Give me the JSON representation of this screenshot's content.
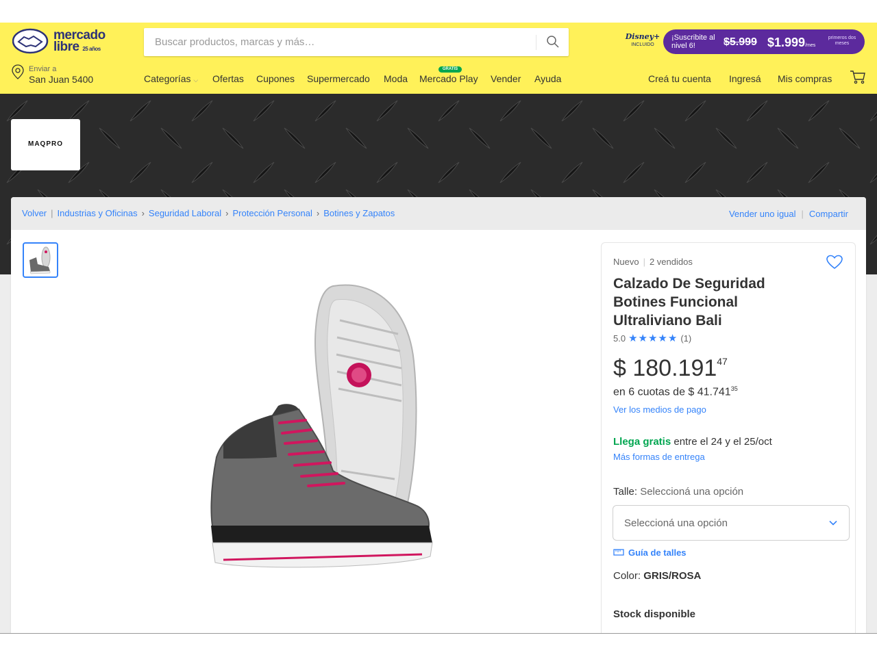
{
  "header": {
    "logo_line1": "mercado",
    "logo_line2": "libre",
    "logo_years": "25 años",
    "search_placeholder": "Buscar productos, marcas y más…",
    "promo": {
      "brand": "Disney+",
      "brand_sub": "INCLUIDO",
      "line1": "¡Suscribite al nivel 6!",
      "old_price": "$5.999",
      "new_price": "$1.999",
      "per": "/mes",
      "note": "primeros dos meses",
      "accent": "#5c2a9d"
    },
    "location_label": "Enviar a",
    "location_value": "San Juan 5400",
    "nav": [
      "Categorías",
      "Ofertas",
      "Cupones",
      "Supermercado",
      "Moda",
      "Mercado Play",
      "Vender",
      "Ayuda"
    ],
    "nav_badge": "GRATIS",
    "user_nav": [
      "Creá tu cuenta",
      "Ingresá",
      "Mis compras"
    ],
    "bg_color": "#fff159"
  },
  "store": {
    "brand": "MAQPRO"
  },
  "breadcrumb": {
    "back": "Volver",
    "items": [
      "Industrias y Oficinas",
      "Seguridad Laboral",
      "Protección Personal",
      "Botines y Zapatos"
    ],
    "right": [
      "Vender uno igual",
      "Compartir"
    ]
  },
  "product": {
    "condition": "Nuevo",
    "sold": "2 vendidos",
    "title": "Calzado De Seguridad Botines Funcional Ultraliviano Bali",
    "rating_value": "5.0",
    "rating_stars": 5,
    "rating_count": "(1)",
    "price_main": "$ 180.191",
    "price_cents": "47",
    "installments_text": "en 6 cuotas de $ 41.741",
    "installments_cents": "35",
    "pay_link": "Ver los medios de pago",
    "shipping_free": "Llega gratis",
    "shipping_rest": " entre el 24 y el 25/oct",
    "delivery_link": "Más formas de entrega",
    "size_label": "Talle:",
    "size_value": "Seleccioná una opción",
    "size_placeholder": "Seleccioná una opción",
    "size_guide": "Guía de talles",
    "color_label": "Color:",
    "color_value": "GRIS/ROSA",
    "stock": "Stock disponible",
    "accent_blue": "#3483fa",
    "accent_green": "#00a650"
  }
}
